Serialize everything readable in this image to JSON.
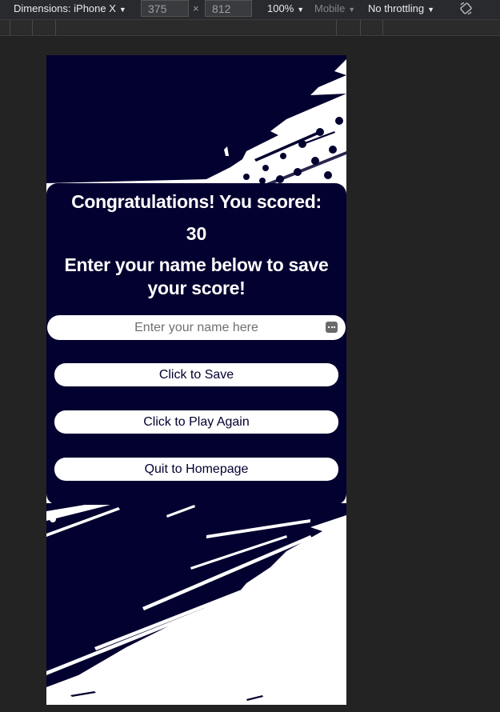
{
  "toolbar": {
    "dimensions_label": "Dimensions: iPhone X",
    "width_value": "375",
    "times": "×",
    "height_value": "812",
    "zoom": "100%",
    "mode": "Mobile",
    "throttling": "No throttling",
    "caret": "▼"
  },
  "end_screen": {
    "congrats": "Congratulations! You scored:",
    "score": "30",
    "prompt": "Enter your name below to save your score!",
    "name_placeholder": "Enter your name here",
    "save_label": "Click to Save",
    "play_again_label": "Click to Play Again",
    "quit_label": "Quit to Homepage"
  },
  "colors": {
    "navy": "#03012f",
    "white": "#ffffff"
  }
}
